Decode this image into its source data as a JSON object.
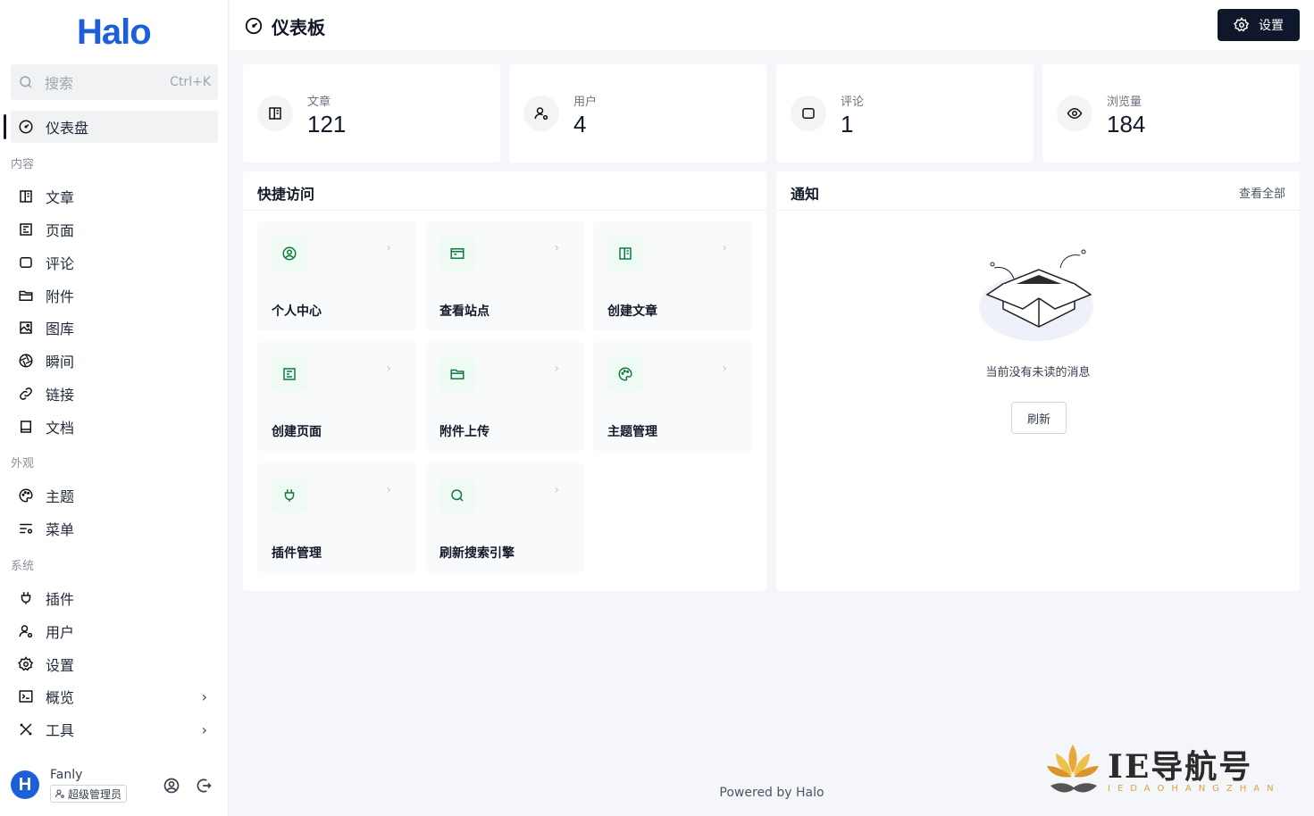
{
  "app": {
    "logo": "Halo"
  },
  "search": {
    "placeholder": "搜索",
    "shortcut": "Ctrl+K"
  },
  "sidebar": {
    "dashboard": "仪表盘",
    "sections": {
      "content": "内容",
      "appearance": "外观",
      "system": "系统"
    },
    "content_items": [
      "文章",
      "页面",
      "评论",
      "附件",
      "图库",
      "瞬间",
      "链接",
      "文档"
    ],
    "appearance_items": [
      "主题",
      "菜单"
    ],
    "system_items": [
      "插件",
      "用户",
      "设置",
      "概览",
      "工具"
    ]
  },
  "user": {
    "avatar_letter": "H",
    "name": "Fanly",
    "role": "超级管理员"
  },
  "header": {
    "title": "仪表板",
    "settings_label": "设置"
  },
  "stats": [
    {
      "label": "文章",
      "value": "121",
      "icon": "book-icon"
    },
    {
      "label": "用户",
      "value": "4",
      "icon": "user-icon"
    },
    {
      "label": "评论",
      "value": "1",
      "icon": "comment-icon"
    },
    {
      "label": "浏览量",
      "value": "184",
      "icon": "eye-icon"
    }
  ],
  "quick_access": {
    "title": "快捷访问",
    "items": [
      "个人中心",
      "查看站点",
      "创建文章",
      "创建页面",
      "附件上传",
      "主题管理",
      "插件管理",
      "刷新搜索引擎"
    ]
  },
  "notifications": {
    "title": "通知",
    "view_all": "查看全部",
    "empty_text": "当前没有未读的消息",
    "refresh_label": "刷新"
  },
  "footer": {
    "text": "Powered by Halo"
  },
  "watermark": {
    "title": "IE导航号",
    "subtitle": "IEDAOHANGZHAN"
  },
  "colors": {
    "brand": "#1d5fd6",
    "accent_green": "#16a34a",
    "dark_button": "#0f172a"
  }
}
